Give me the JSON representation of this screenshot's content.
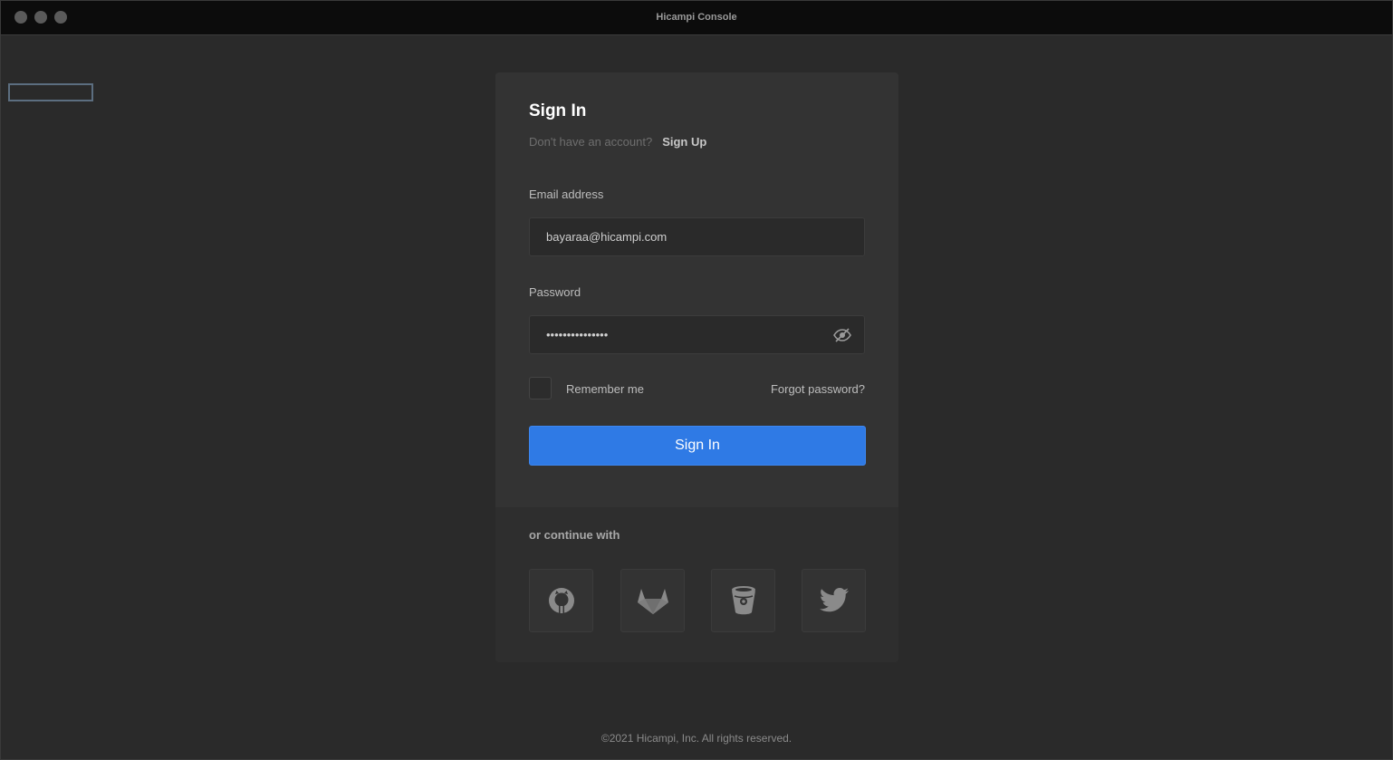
{
  "window": {
    "title": "Hicampi Console"
  },
  "signin": {
    "heading": "Sign In",
    "no_account_text": "Don't have an account?",
    "signup_link": "Sign Up",
    "email_label": "Email address",
    "email_value": "bayaraa@hicampi.com",
    "password_label": "Password",
    "password_value": "•••••••••••••••",
    "remember_label": "Remember me",
    "remember_checked": false,
    "forgot_link": "Forgot password?",
    "submit_label": "Sign In"
  },
  "social": {
    "heading": "or continue with",
    "providers": [
      "github-icon",
      "gitlab-icon",
      "bitbucket-icon",
      "twitter-icon"
    ]
  },
  "footer": {
    "text": "©2021 Hicampi, Inc. All rights reserved."
  },
  "colors": {
    "background": "#2a2a2a",
    "card": "#333333",
    "accent": "#2f7ae5",
    "icon": "#8a8a8a"
  }
}
